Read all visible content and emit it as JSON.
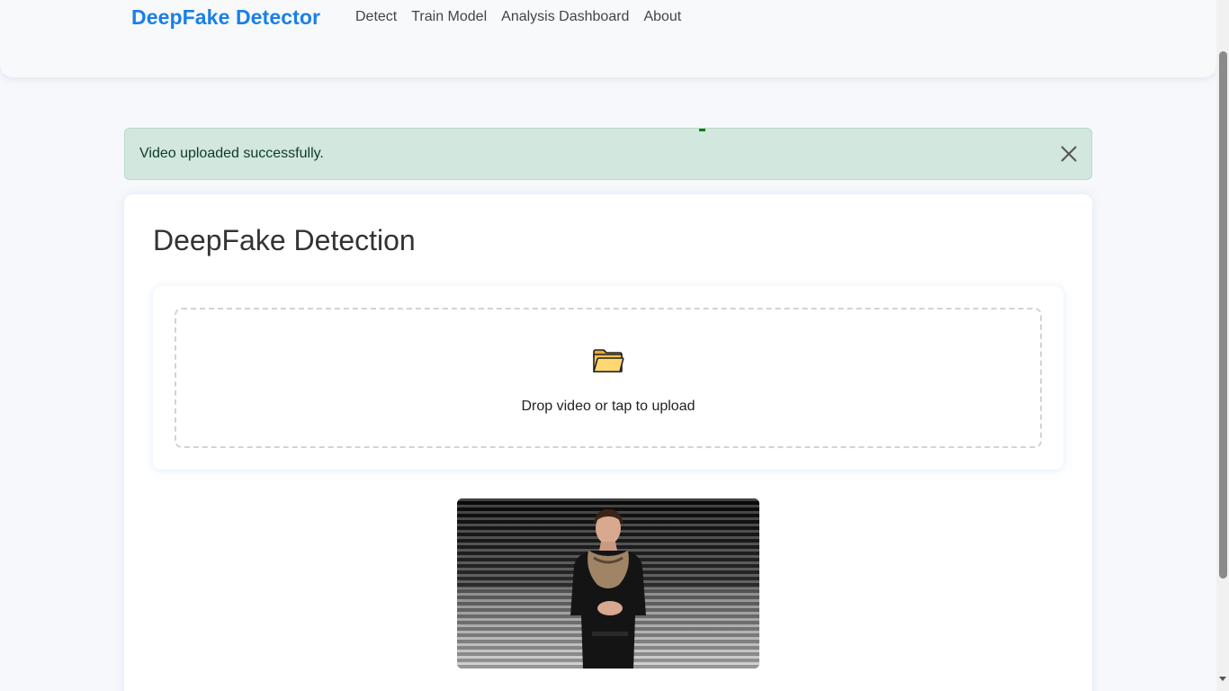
{
  "navbar": {
    "brand": "DeepFake Detector",
    "links": [
      "Detect",
      "Train Model",
      "Analysis Dashboard",
      "About"
    ]
  },
  "alert": {
    "message": "Video uploaded successfully."
  },
  "main": {
    "title": "DeepFake Detection",
    "upload": {
      "icon": "folder-icon",
      "prompt": "Drop video or tap to upload"
    },
    "video_preview": {
      "icon": "video-thumbnail"
    }
  },
  "colors": {
    "brand": "#1a7fe8",
    "alert_bg": "#d2e7dd",
    "alert_text": "#0f3a26",
    "page_bg": "#f6f8fb"
  }
}
